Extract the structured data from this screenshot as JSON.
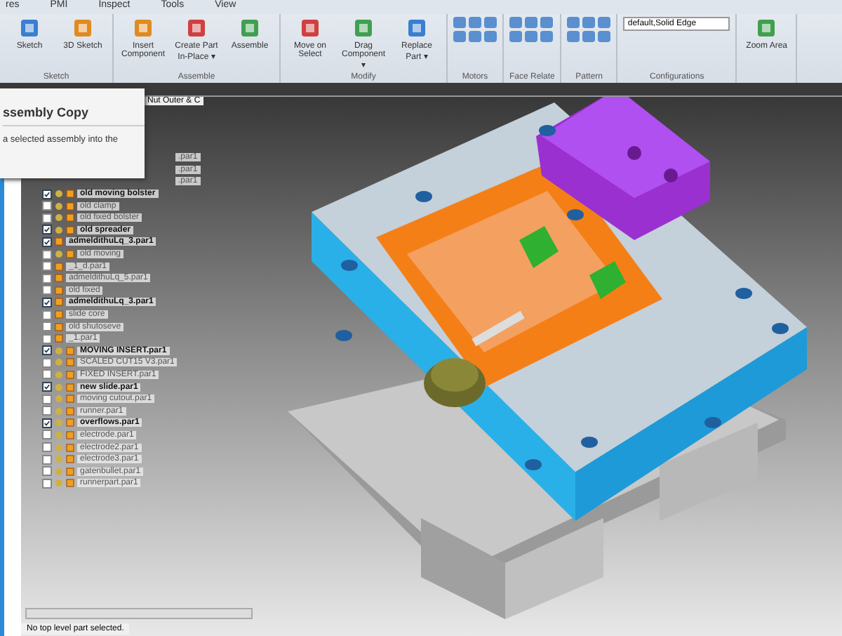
{
  "ribbon": {
    "tabs": [
      {
        "label": "res",
        "selected": false
      },
      {
        "label": "PMI",
        "selected": false
      },
      {
        "label": "Inspect",
        "selected": false
      },
      {
        "label": "Tools",
        "selected": false
      },
      {
        "label": "View",
        "selected": false
      }
    ],
    "groups": [
      {
        "title": "Sketch",
        "buttons": [
          "Sketch",
          "3D Sketch"
        ]
      },
      {
        "title": "Assemble",
        "buttons": [
          "Insert Component",
          "Create Part In-Place ▾",
          "Assemble"
        ]
      },
      {
        "title": "Modify",
        "buttons": [
          "Move on Select",
          "Drag Component ▾",
          "Replace Part ▾"
        ]
      },
      {
        "title": "Motors"
      },
      {
        "title": "Face Relate"
      },
      {
        "title": "Pattern"
      },
      {
        "title": "Configurations",
        "dropdown": "default,Solid Edge"
      },
      {
        "buttons": [
          "Zoom Area"
        ]
      }
    ]
  },
  "document_tab": "Nut Outer & C",
  "tooltip": {
    "title": "ssembly Copy",
    "text": "a selected assembly into the"
  },
  "tree": [
    {
      "label": ".par1",
      "kind": "partial"
    },
    {
      "label": ".par1",
      "kind": "partial"
    },
    {
      "label": ".par1",
      "kind": "partial"
    },
    {
      "label": "old moving bolster",
      "checked": true,
      "kind": "assembly"
    },
    {
      "label": "old clamp",
      "checked": false,
      "kind": "assembly"
    },
    {
      "label": "old fixed bolster",
      "checked": false,
      "kind": "assembly"
    },
    {
      "label": "old spreader",
      "checked": true,
      "kind": "assembly"
    },
    {
      "label": "admeldithuLq_3.par1",
      "checked": true,
      "kind": "part"
    },
    {
      "label": "old moving",
      "checked": false,
      "kind": "assembly"
    },
    {
      "label": "_1_d.par1",
      "checked": false,
      "kind": "part"
    },
    {
      "label": "admeldithuLq_5.par1",
      "checked": false,
      "kind": "part"
    },
    {
      "label": "old fixed",
      "checked": false,
      "kind": "part"
    },
    {
      "label": "admeldithuLq_3.par1",
      "checked": true,
      "kind": "part"
    },
    {
      "label": "slide core",
      "checked": false,
      "kind": "part"
    },
    {
      "label": "old shutoseve",
      "checked": false,
      "kind": "part"
    },
    {
      "label": "_1.par1",
      "checked": false,
      "kind": "part"
    },
    {
      "label": "MOVING INSERT.par1",
      "checked": true,
      "kind": "assembly"
    },
    {
      "label": "SCALED CUT15 V3.par1",
      "checked": false,
      "kind": "assembly"
    },
    {
      "label": "FIXED INSERT.par1",
      "checked": false,
      "kind": "assembly"
    },
    {
      "label": "new slide.par1",
      "checked": true,
      "kind": "assembly"
    },
    {
      "label": "moving cutout.par1",
      "checked": false,
      "kind": "assembly"
    },
    {
      "label": "runner.par1",
      "checked": false,
      "kind": "assembly"
    },
    {
      "label": "overflows.par1",
      "checked": true,
      "kind": "assembly"
    },
    {
      "label": "electrode.par1",
      "checked": false,
      "kind": "assembly"
    },
    {
      "label": "electrode2.par1",
      "checked": false,
      "kind": "assembly"
    },
    {
      "label": "electrode3.par1",
      "checked": false,
      "kind": "assembly"
    },
    {
      "label": "gatenbullet.par1",
      "checked": false,
      "kind": "assembly"
    },
    {
      "label": "runnerpart.par1",
      "checked": false,
      "kind": "assembly"
    }
  ],
  "status_bar": "No top level part selected."
}
